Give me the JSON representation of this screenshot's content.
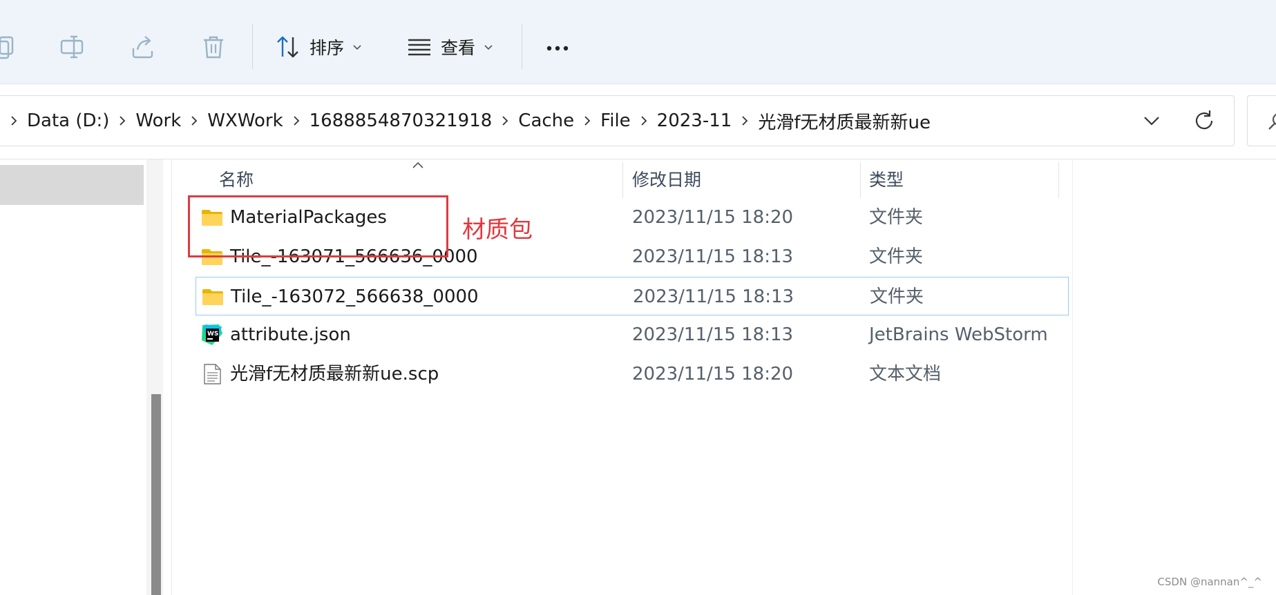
{
  "toolbar": {
    "sort_label": "排序",
    "view_label": "查看",
    "icons": [
      "copy-icon",
      "rename-icon",
      "share-icon",
      "delete-icon",
      "sort-icon",
      "view-icon",
      "more-icon"
    ]
  },
  "address_bar": {
    "path": [
      "Data (D:)",
      "Work",
      "WXWork",
      "1688854870321918",
      "Cache",
      "File",
      "2023-11",
      "光滑f无材质最新新ue"
    ]
  },
  "file_list": {
    "columns": {
      "name": "名称",
      "modified": "修改日期",
      "type": "类型"
    },
    "rows": [
      {
        "name": "MaterialPackages",
        "modified": "2023/11/15 18:20",
        "type": "文件夹",
        "icon": "folder-icon"
      },
      {
        "name": "Tile_-163071_566636_0000",
        "modified": "2023/11/15 18:13",
        "type": "文件夹",
        "icon": "folder-icon"
      },
      {
        "name": "Tile_-163072_566638_0000",
        "modified": "2023/11/15 18:13",
        "type": "文件夹",
        "icon": "folder-icon",
        "selected": true
      },
      {
        "name": "attribute.json",
        "modified": "2023/11/15 18:13",
        "type": "JetBrains WebStorm",
        "icon": "webstorm-file-icon"
      },
      {
        "name": "光滑f无材质最新新ue.scp",
        "modified": "2023/11/15 18:20",
        "type": "文本文档",
        "icon": "text-file-icon"
      }
    ]
  },
  "annotation": {
    "label": "材质包",
    "color": "#e0393e"
  },
  "watermark": "CSDN @nannan^_^"
}
